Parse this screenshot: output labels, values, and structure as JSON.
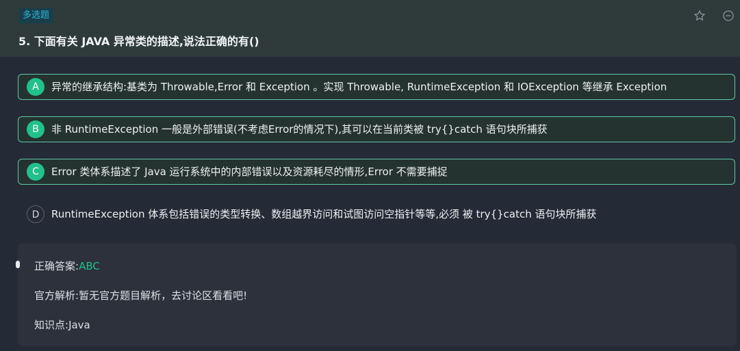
{
  "question": {
    "tag": "多选题",
    "title": "5. 下面有关 JAVA 异常类的描述,说法正确的有()"
  },
  "icons": {
    "star": "star-icon",
    "collapse": "minus-circle-icon"
  },
  "options": [
    {
      "letter": "A",
      "text": "异常的继承结构:基类为 Throwable,Error 和 Exception 。实现 Throwable, RuntimeException 和 IOException 等继承 Exception",
      "selected": true
    },
    {
      "letter": "B",
      "text": "非 RuntimeException 一般是外部错误(不考虑Error的情况下),其可以在当前类被 try{}catch 语句块所捕获",
      "selected": true
    },
    {
      "letter": "C",
      "text": "Error 类体系描述了 Java 运行系统中的内部错误以及资源耗尽的情形,Error 不需要捕捉",
      "selected": true
    },
    {
      "letter": "D",
      "text": "RuntimeException 体系包括错误的类型转换、数组越界访问和试图访问空指针等等,必须 被 try{}catch 语句块所捕获",
      "selected": false
    }
  ],
  "analysis": {
    "answer_label": "正确答案:",
    "answer_value": "ABC",
    "official_label": "官方解析:",
    "official_value": "暂无官方题目解析，去讨论区看看吧!",
    "knowledge_label": "知识点:",
    "knowledge_value": "Java"
  },
  "colors": {
    "accent_green": "#22c08a",
    "option_border": "#5fc7a3",
    "tag_text": "#2fb4d6",
    "background": "#242a36"
  }
}
